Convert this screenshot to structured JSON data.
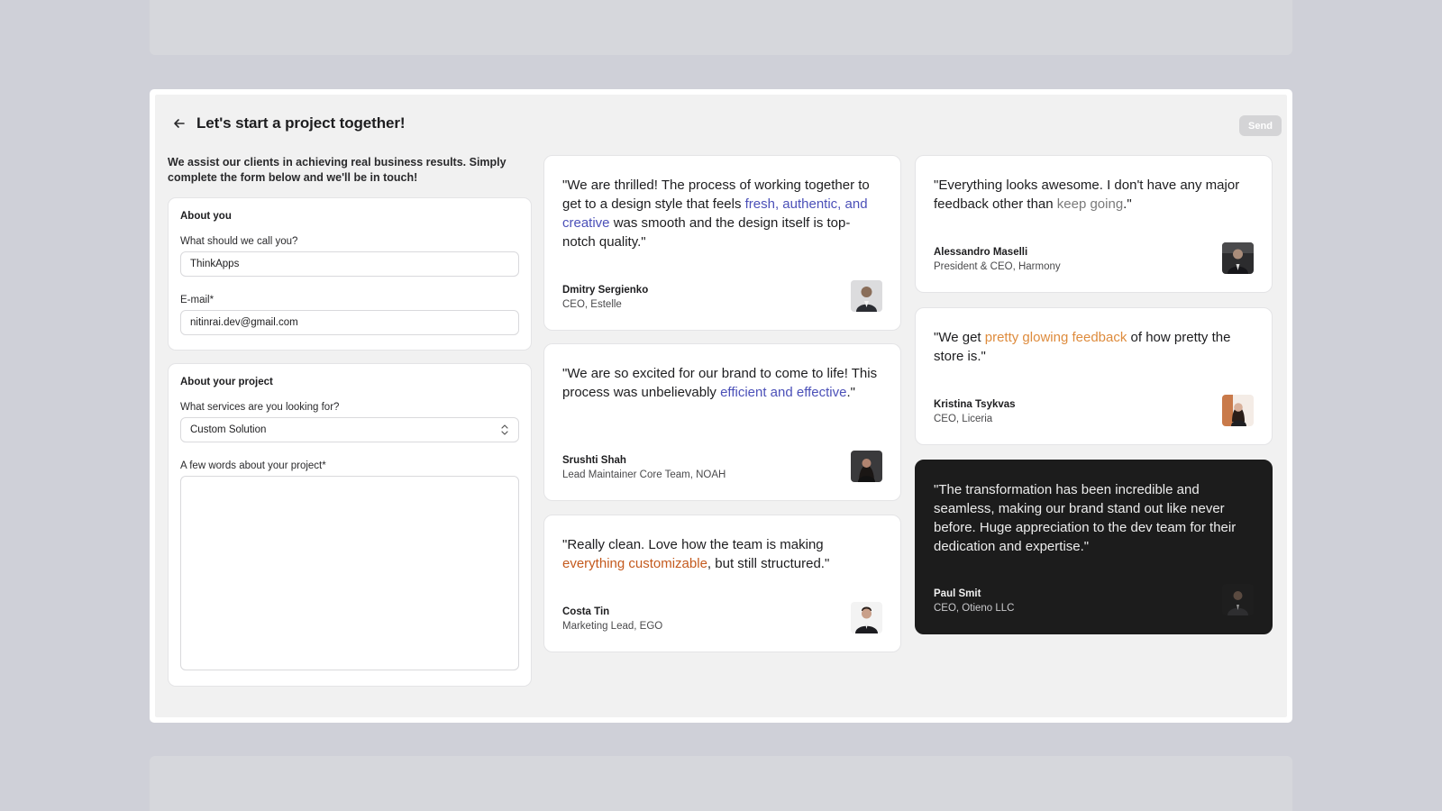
{
  "header": {
    "title": "Let's start a project together!",
    "send_label": "Send"
  },
  "intro": "We assist our clients in achieving real business results. Simply complete the form below and we'll be in touch!",
  "form": {
    "about_you": {
      "title": "About you",
      "name_label": "What should we call you?",
      "name_value": "ThinkApps",
      "email_label": "E-mail*",
      "email_value": "nitinrai.dev@gmail.com"
    },
    "about_project": {
      "title": "About your project",
      "services_label": "What services are you looking for?",
      "services_value": "Custom Solution",
      "description_label": "A few words about your project*",
      "description_value": ""
    }
  },
  "testimonials": [
    {
      "quote_parts": [
        {
          "text": "\"We are thrilled! The process of working together to get to a design style that feels ",
          "hl": ""
        },
        {
          "text": "fresh, authentic, and creative",
          "hl": "blue"
        },
        {
          "text": " was smooth and the design itself is top-notch quality.\"",
          "hl": ""
        }
      ],
      "name": "Dmitry Sergienko",
      "role": "CEO, Estelle"
    },
    {
      "quote_parts": [
        {
          "text": "\"We are so excited for our brand to come to life! This process was unbelievably ",
          "hl": ""
        },
        {
          "text": "efficient and effective",
          "hl": "blue"
        },
        {
          "text": ".\"",
          "hl": ""
        }
      ],
      "name": "Srushti Shah",
      "role": "Lead Maintainer Core Team, NOAH"
    },
    {
      "quote_parts": [
        {
          "text": "\"Really clean. Love how the team is making ",
          "hl": ""
        },
        {
          "text": "everything customizable",
          "hl": "rust"
        },
        {
          "text": ", but still structured.\"",
          "hl": ""
        }
      ],
      "name": "Costa Tin",
      "role": "Marketing Lead, EGO"
    },
    {
      "quote_parts": [
        {
          "text": "\"Everything looks awesome. I don't have any major feedback other than ",
          "hl": ""
        },
        {
          "text": "keep going",
          "hl": "gray"
        },
        {
          "text": ".\"",
          "hl": ""
        }
      ],
      "name": "Alessandro Maselli",
      "role": "President & CEO, Harmony"
    },
    {
      "quote_parts": [
        {
          "text": "\"We get ",
          "hl": ""
        },
        {
          "text": "pretty glowing feedback",
          "hl": "orange"
        },
        {
          "text": " of how pretty the store is.\"",
          "hl": ""
        }
      ],
      "name": "Kristina Tsykvas",
      "role": "CEO, Liceria"
    },
    {
      "quote_parts": [
        {
          "text": "\"The transformation has been incredible and seamless, making our brand stand out like never before. Huge appreciation to the dev team for their dedication and expertise.\"",
          "hl": ""
        }
      ],
      "name": "Paul Smit",
      "role": "CEO, Otieno LLC"
    }
  ],
  "colors": {
    "page_bg": "#cfd0d8",
    "highlight_blue": "#4b50b8",
    "highlight_orange": "#de8b3c",
    "highlight_rust": "#c45a1e",
    "highlight_gray": "#7a7a7a",
    "dark_card": "#1c1c1c"
  },
  "icons": {
    "back": "arrow-left-icon",
    "select": "chevron-up-down-icon"
  }
}
